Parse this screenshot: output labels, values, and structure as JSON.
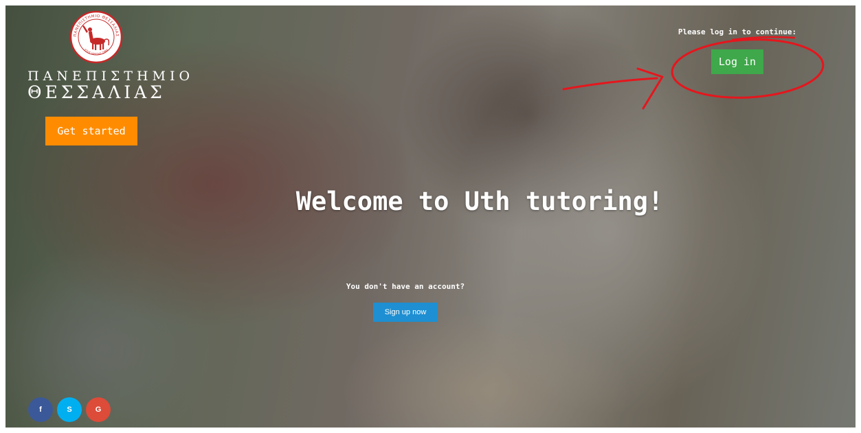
{
  "brand": {
    "line1": "ΠΑΝΕΠΙΣΤΗΜΙΟ",
    "line2": "ΘΕΣΣΑΛΙΑΣ",
    "seal_text": "ΠΑΝΕΠΙΣΤΗΜΙΟ ΘΕΣΣΑΛΙΑΣ",
    "seal_year": "ΕΤΟΣ ΙΔΡΥΣΗΣ 1984",
    "seal_color": "#c62828"
  },
  "hero": {
    "get_started_label": "Get started",
    "welcome_text": "Welcome to Uth tutoring!",
    "no_account_text": "You don't have an account?",
    "signup_label": "Sign up now"
  },
  "login": {
    "prompt": "Please log in to continue:",
    "button_label": "Log in"
  },
  "social": [
    {
      "name": "facebook",
      "glyph": "f",
      "color": "#3b5998"
    },
    {
      "name": "skype",
      "glyph": "S",
      "color": "#00aff0"
    },
    {
      "name": "google",
      "glyph": "G",
      "color": "#dd4b39"
    }
  ],
  "colors": {
    "accent_orange": "#ff8c00",
    "login_green": "#3ea84a",
    "signup_blue": "#1e8fd2",
    "annotation_red": "#e5161d"
  }
}
